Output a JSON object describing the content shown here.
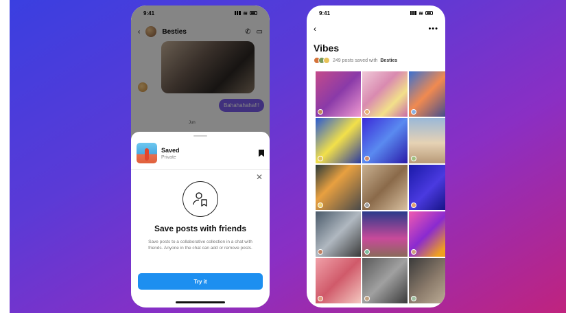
{
  "left_phone": {
    "status_time": "9:41",
    "chat": {
      "title": "Besties",
      "bubble_text": "Bahahahaha!!!",
      "date_text": "Jun"
    },
    "sheet": {
      "saved_title": "Saved",
      "saved_subtitle": "Private",
      "heading": "Save posts with friends",
      "body": "Save posts to a collaborative collection in a chat with friends. Anyone in the chat can add or remove posts.",
      "button_label": "Try it"
    }
  },
  "right_phone": {
    "status_time": "9:41",
    "collection_title": "Vibes",
    "posts_meta": "249 posts saved with",
    "group_name": "Besties",
    "grid_cells": [
      {
        "bg": "linear-gradient(135deg,#c44b8a,#8a3aa8 50%,#f09ad0)",
        "dot": "#c48a5a"
      },
      {
        "bg": "linear-gradient(135deg,#f0c9d8,#d98ab0 40%,#f2e08a 70%,#c86aa8)",
        "dot": "#e8b070"
      },
      {
        "bg": "linear-gradient(135deg,#3a70d0,#f08a50 45%,#1f3f9a)",
        "dot": "#8ab0e0"
      },
      {
        "bg": "linear-gradient(135deg,#2a5ad0,#f2e04a 50%,#2a3aa0)",
        "dot": "#e0c060"
      },
      {
        "bg": "linear-gradient(135deg,#3a2ad8,#5a8af0 50%,#2a1aa8)",
        "dot": "#d08a6a"
      },
      {
        "bg": "linear-gradient(180deg,#9ab8d8,#e6d2b4 55%,#b89a78)",
        "dot": "#a0c080"
      },
      {
        "bg": "linear-gradient(135deg,#2a3a3a,#e8a040 40%,#4a4a4a)",
        "dot": "#f0d070"
      },
      {
        "bg": "linear-gradient(135deg,#c8b090,#8a6a4a 50%,#d8c0a0)",
        "dot": "#a0a0a0"
      },
      {
        "bg": "linear-gradient(135deg,#1a1aa8,#4a3ae0 50%,#0a0a70)",
        "dot": "#e0a070"
      },
      {
        "bg": "linear-gradient(135deg,#4a5a6a,#b0b8c0 50%,#3a3a3a)",
        "dot": "#c08060"
      },
      {
        "bg": "linear-gradient(180deg,#2a3a8a,#c84a9a 60%,#8a6a5a)",
        "dot": "#80c0a0"
      },
      {
        "bg": "linear-gradient(135deg,#f05ab0,#8a2ad0 45%,#f0a020 80%)",
        "dot": "#d0a080"
      },
      {
        "bg": "linear-gradient(135deg,#f0a0a8,#d05a6a 50%,#f4c8c0)",
        "dot": "#e0a080"
      },
      {
        "bg": "linear-gradient(135deg,#5a5a5a,#a0a0a0 50%,#3a3a3a)",
        "dot": "#c0a080"
      },
      {
        "bg": "linear-gradient(135deg,#3a3a3a,#8a7a6a 50%,#c8b8a0)",
        "dot": "#a0c0a0"
      }
    ]
  }
}
